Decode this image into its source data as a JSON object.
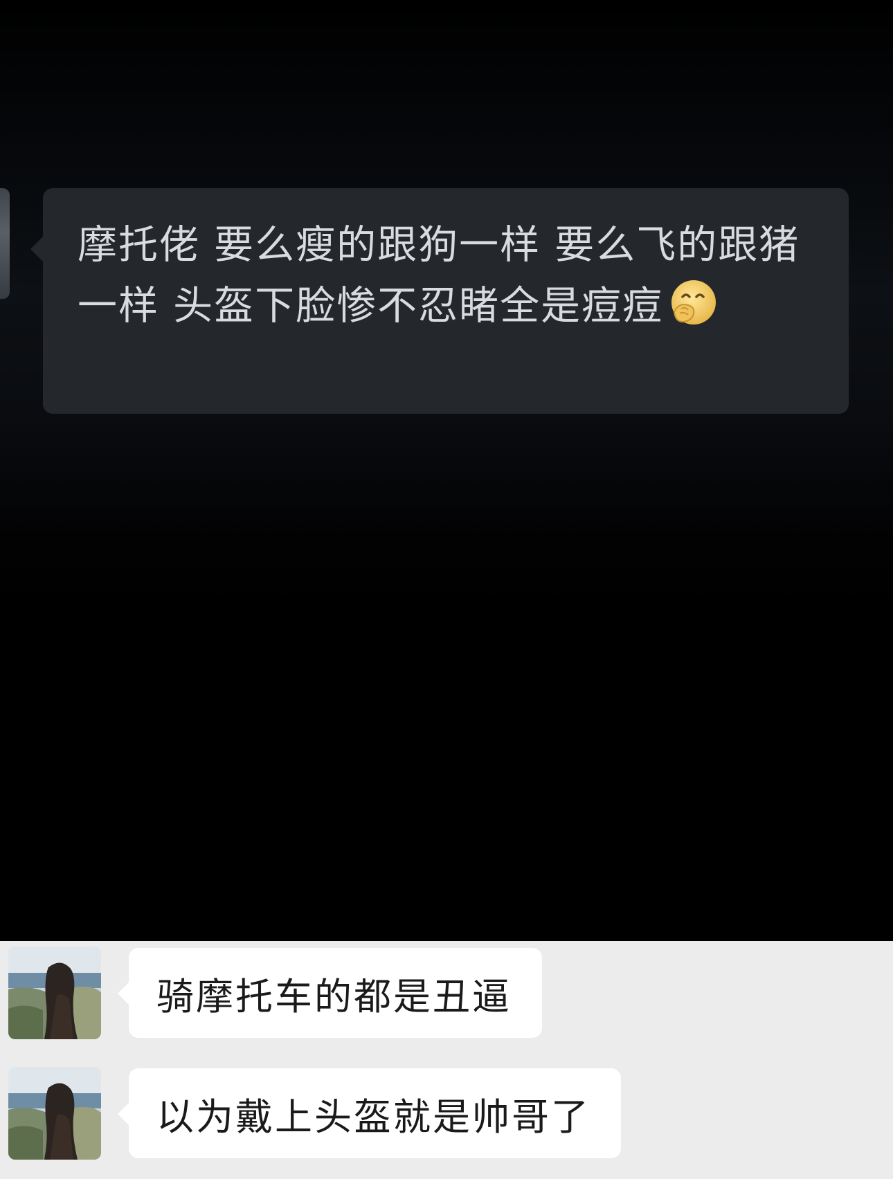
{
  "chat": {
    "top_message": {
      "text": "摩托佬 要么瘦的跟狗一样 要么飞的跟猪一样 头盔下脸惨不忍睹全是痘痘",
      "emoji": "smiling-hand-over-mouth-emoji"
    },
    "messages": [
      {
        "text": "骑摩托车的都是丑逼",
        "avatar": "woman-long-hair-seaside-photo"
      },
      {
        "text": "以为戴上头盔就是帅哥了",
        "avatar": "woman-long-hair-seaside-photo"
      }
    ]
  },
  "colors": {
    "dark_background": "#000000",
    "dark_bubble": "#24272c",
    "dark_text": "#d9dbde",
    "light_background": "#ececec",
    "light_bubble": "#ffffff",
    "light_text": "#1a1a1a"
  }
}
